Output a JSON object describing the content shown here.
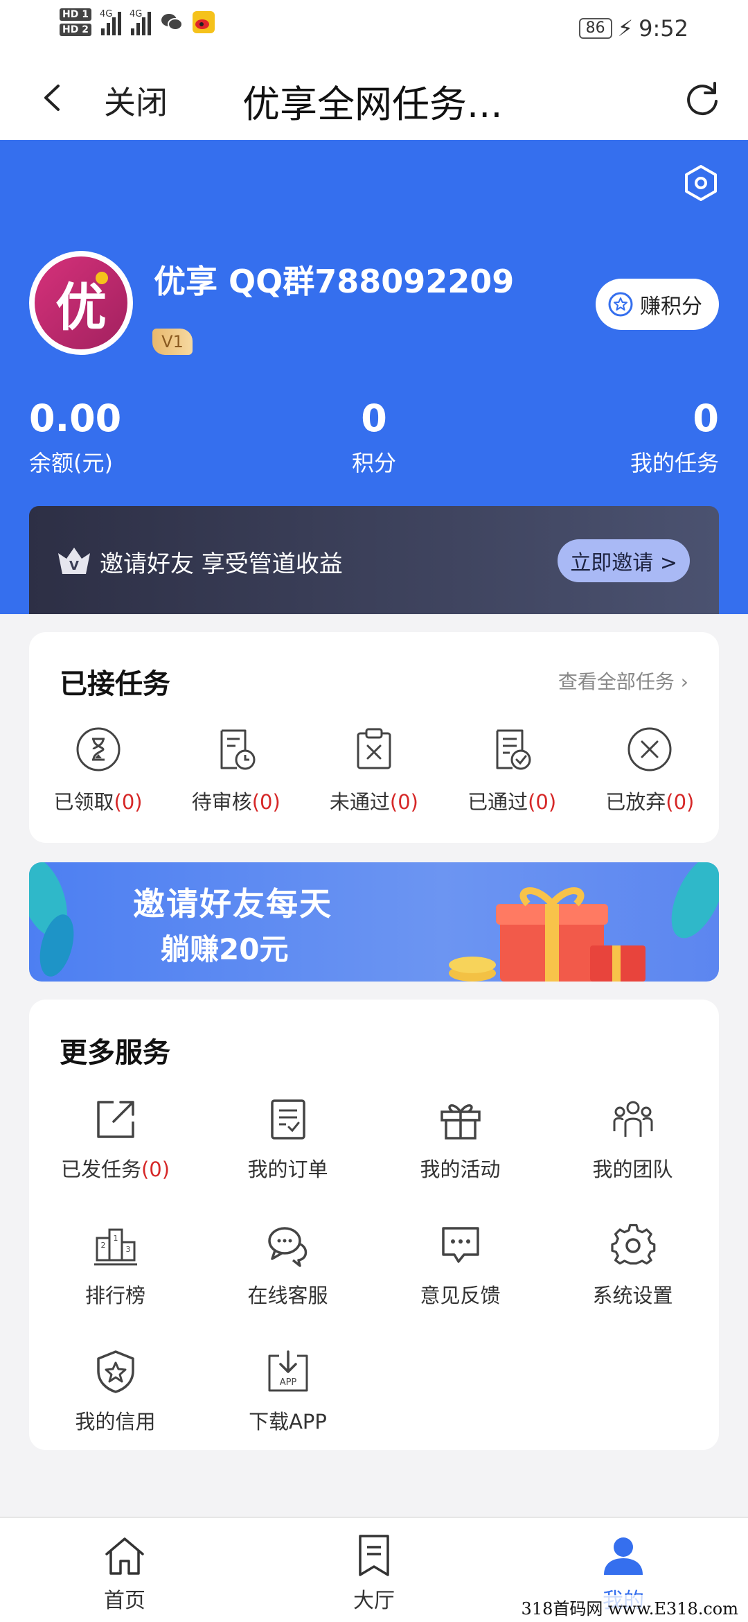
{
  "status_bar": {
    "hd1": "HD 1",
    "hd2": "HD 2",
    "net1": "4G",
    "net2": "4G",
    "battery": "86",
    "time": "9:52"
  },
  "nav": {
    "close": "关闭",
    "title": "优享全网任务..."
  },
  "profile": {
    "avatar_char": "优",
    "username": "优享 QQ群788092209",
    "level": "V1",
    "earn_button": "赚积分",
    "stats": {
      "balance_value": "0.00",
      "balance_label": "余额(元)",
      "points_value": "0",
      "points_label": "积分",
      "tasks_value": "0",
      "tasks_label": "我的任务"
    },
    "invite": {
      "text": "邀请好友 享受管道收益",
      "button": "立即邀请 >"
    }
  },
  "accepted_tasks": {
    "title": "已接任务",
    "view_all": "查看全部任务 ›",
    "items": [
      {
        "label": "已领取",
        "count": "(0)",
        "icon": "hourglass-icon"
      },
      {
        "label": "待审核",
        "count": "(0)",
        "icon": "document-clock-icon"
      },
      {
        "label": "未通过",
        "count": "(0)",
        "icon": "clipboard-x-icon"
      },
      {
        "label": "已通过",
        "count": "(0)",
        "icon": "document-check-icon"
      },
      {
        "label": "已放弃",
        "count": "(0)",
        "icon": "circle-x-icon"
      }
    ]
  },
  "banner": {
    "line1": "邀请好友每天",
    "line2": "躺赚20元"
  },
  "services": {
    "title": "更多服务",
    "items": [
      {
        "label": "已发任务",
        "count": "(0)",
        "icon": "external-link-icon"
      },
      {
        "label": "我的订单",
        "icon": "order-icon"
      },
      {
        "label": "我的活动",
        "icon": "gift-icon"
      },
      {
        "label": "我的团队",
        "icon": "team-icon"
      },
      {
        "label": "排行榜",
        "icon": "podium-icon"
      },
      {
        "label": "在线客服",
        "icon": "chat-bubbles-icon"
      },
      {
        "label": "意见反馈",
        "icon": "feedback-icon"
      },
      {
        "label": "系统设置",
        "icon": "gear-icon"
      },
      {
        "label": "我的信用",
        "icon": "shield-star-icon"
      },
      {
        "label": "下载APP",
        "icon": "download-app-icon"
      }
    ]
  },
  "bottom_nav": [
    {
      "label": "首页",
      "icon": "home-icon",
      "active": false
    },
    {
      "label": "大厅",
      "icon": "bookmark-doc-icon",
      "active": false
    },
    {
      "label": "我的",
      "icon": "user-icon",
      "active": true
    }
  ],
  "watermark": "318首码网 www.E318.com",
  "colors": {
    "brand_blue": "#356fee",
    "count_red": "#d62828"
  }
}
